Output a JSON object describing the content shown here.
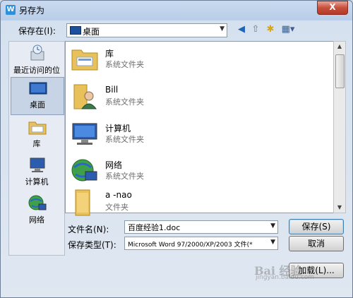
{
  "window": {
    "title": "另存为",
    "app_icon_letter": "W",
    "close_glyph": "X"
  },
  "toolbar": {
    "save_in_label": "保存在(I):",
    "location": "桌面",
    "back_icon": "back-icon",
    "up_icon": "up-folder-icon",
    "new_folder_icon": "new-folder-icon",
    "views_icon": "views-menu-icon"
  },
  "places": [
    {
      "label": "最近访问的位置",
      "icon": "recent-places-icon"
    },
    {
      "label": "桌面",
      "icon": "desktop-icon",
      "selected": true
    },
    {
      "label": "库",
      "icon": "libraries-icon"
    },
    {
      "label": "计算机",
      "icon": "computer-icon"
    },
    {
      "label": "网络",
      "icon": "network-icon"
    }
  ],
  "files": [
    {
      "name": "库",
      "type": "系统文件夹",
      "icon": "libraries-folder-icon"
    },
    {
      "name": "Bill",
      "type": "系统文件夹",
      "icon": "user-folder-icon"
    },
    {
      "name": "计算机",
      "type": "系统文件夹",
      "icon": "computer-icon"
    },
    {
      "name": "网络",
      "type": "系统文件夹",
      "icon": "network-icon"
    },
    {
      "name": "a -nao",
      "type": "文件夹",
      "icon": "folder-icon"
    }
  ],
  "form": {
    "filename_label": "文件名(N):",
    "filename_value": "百度经验1.doc",
    "filetype_label": "保存类型(T):",
    "filetype_value": "Microsoft Word 97/2000/XP/2003 文件(*"
  },
  "buttons": {
    "save": "保存(S)",
    "cancel": "取消",
    "load": "加载(L)..."
  },
  "watermark": {
    "text": "Bai 经验",
    "sub": "jingyan.baidu.com"
  },
  "colors": {
    "accent": "#3c7fb1",
    "close": "#c7503d",
    "folder": "#e8c15a"
  }
}
